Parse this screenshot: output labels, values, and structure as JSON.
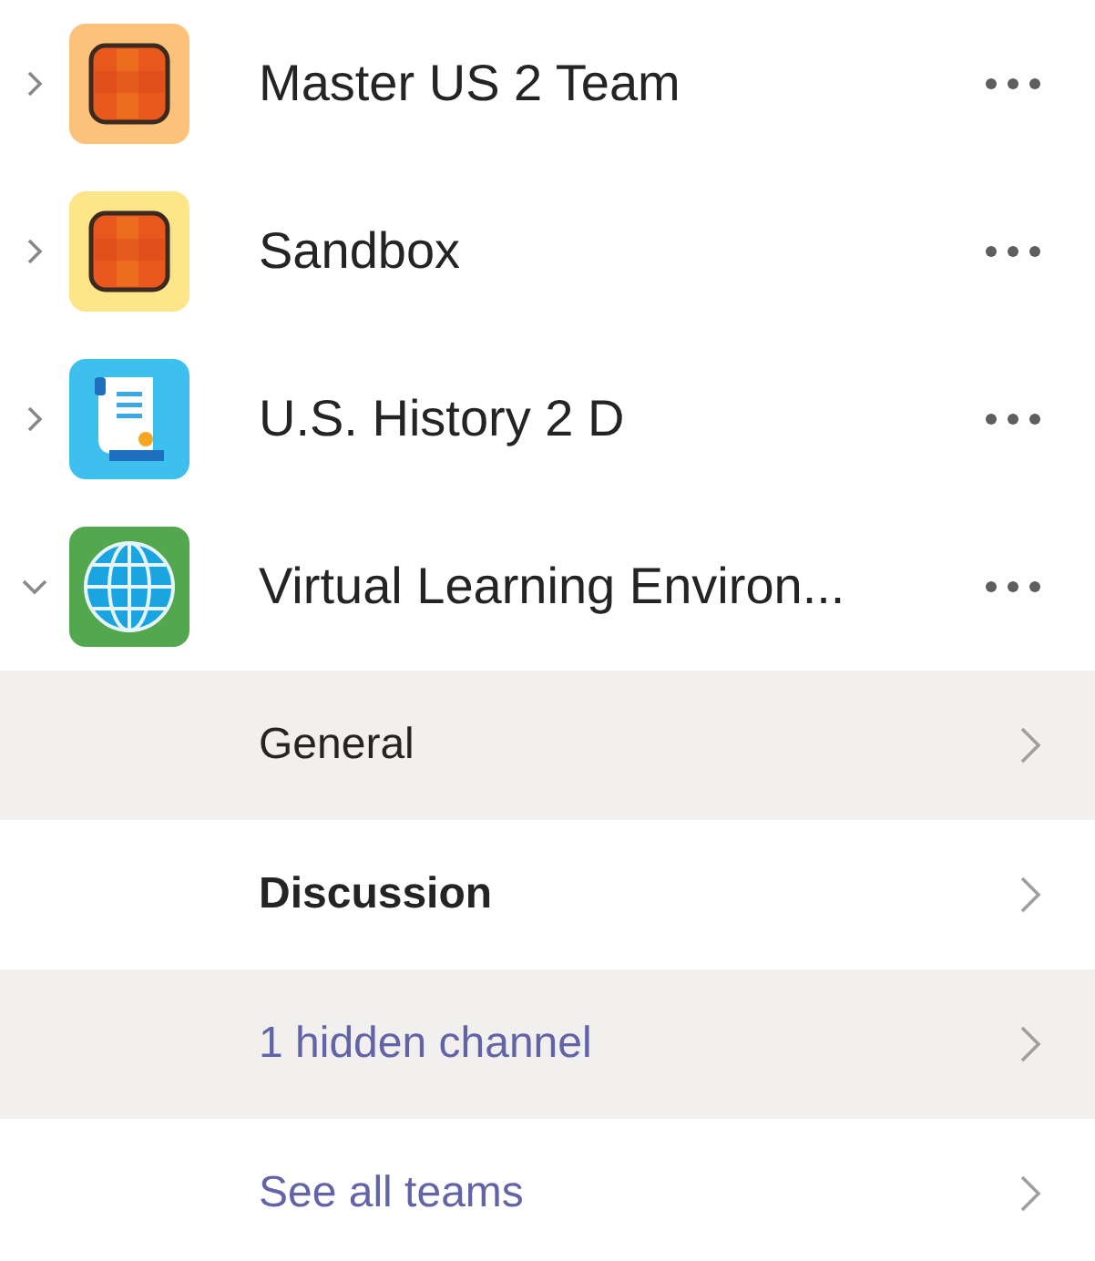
{
  "teams": [
    {
      "name": "Master US 2 Team",
      "expanded": false,
      "kind": "tile",
      "color": "#fdc27a"
    },
    {
      "name": "Sandbox",
      "expanded": false,
      "kind": "tile",
      "color": "#fde58a"
    },
    {
      "name": "U.S. History 2 D",
      "expanded": false,
      "kind": "scroll",
      "color": "#3ec0ef"
    },
    {
      "name": "Virtual Learning Environ...",
      "expanded": true,
      "kind": "globe",
      "color": "#53a84f"
    }
  ],
  "channels": [
    {
      "label": "General",
      "kind": "channel",
      "unread": false,
      "highlighted": true
    },
    {
      "label": "Discussion",
      "kind": "channel",
      "unread": true,
      "highlighted": false
    },
    {
      "label": "1 hidden channel",
      "kind": "link",
      "unread": false,
      "highlighted": true
    },
    {
      "label": "See all teams",
      "kind": "link",
      "unread": false,
      "highlighted": false
    }
  ]
}
